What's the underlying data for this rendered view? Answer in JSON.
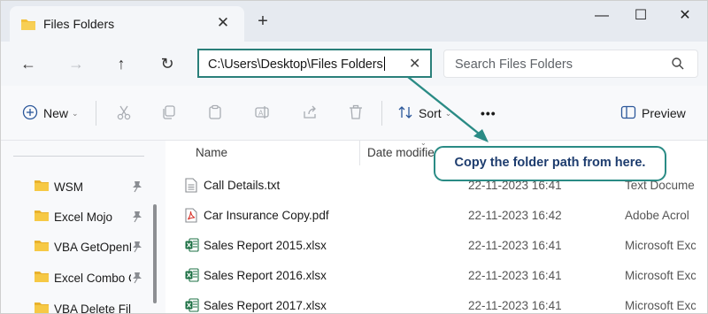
{
  "tab": {
    "title": "Files Folders",
    "close": "✕",
    "new_tab": "+"
  },
  "window": {
    "minimize": "—",
    "maximize": "☐",
    "close": "✕"
  },
  "nav": {
    "back": "←",
    "forward": "→",
    "up": "↑",
    "refresh": "↻",
    "address_path": "C:\\Users\\Desktop\\Files Folders",
    "address_clear": "✕",
    "search_placeholder": "Search Files Folders"
  },
  "toolbar": {
    "new_label": "New",
    "sort_label": "Sort",
    "more_label": "•••",
    "preview_label": "Preview"
  },
  "sidebar": {
    "items": [
      {
        "label": "WSM"
      },
      {
        "label": "Excel Mojo"
      },
      {
        "label": "VBA GetOpenF"
      },
      {
        "label": "Excel Combo C"
      },
      {
        "label": "VBA Delete File"
      }
    ]
  },
  "columns": {
    "name": "Name",
    "date": "Date modifie"
  },
  "files": [
    {
      "name": "Call Details.txt",
      "date": "22-11-2023 16:41",
      "type": "Text Docume",
      "icon": "text-file-icon"
    },
    {
      "name": "Car Insurance Copy.pdf",
      "date": "22-11-2023 16:42",
      "type": "Adobe Acrol",
      "icon": "pdf-file-icon"
    },
    {
      "name": "Sales Report 2015.xlsx",
      "date": "22-11-2023 16:41",
      "type": "Microsoft Exc",
      "icon": "excel-file-icon"
    },
    {
      "name": "Sales Report 2016.xlsx",
      "date": "22-11-2023 16:41",
      "type": "Microsoft Exc",
      "icon": "excel-file-icon"
    },
    {
      "name": "Sales Report 2017.xlsx",
      "date": "22-11-2023 16:41",
      "type": "Microsoft Exc",
      "icon": "excel-file-icon"
    }
  ],
  "callout": {
    "text": "Copy the folder path from here."
  },
  "colors": {
    "accent": "#2a8b85",
    "callout_text": "#1d3c6e",
    "folder": "#f3c03a",
    "excel": "#1e7145",
    "pdf": "#d7322a"
  }
}
